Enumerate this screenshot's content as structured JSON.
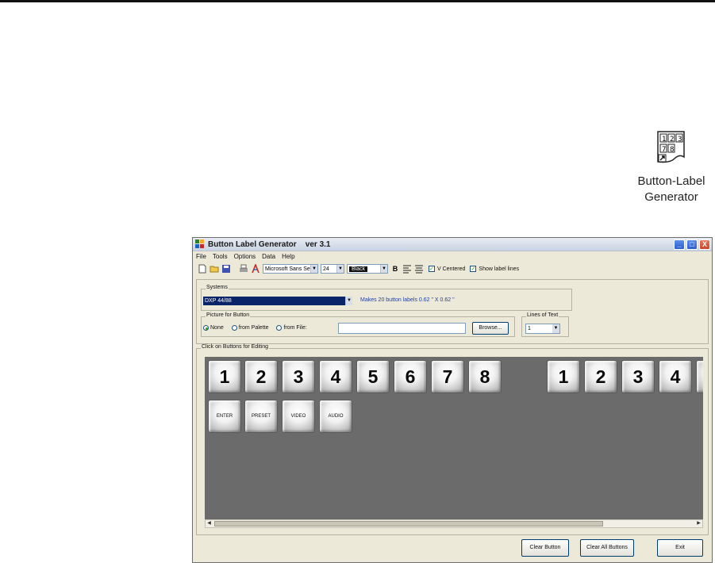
{
  "desktop_icon": {
    "caption": "Button-Label\nGenerator"
  },
  "window": {
    "title": "Button Label Generator    ver 3.1",
    "controls": {
      "minimize": "_",
      "maximize": "□",
      "close": "X"
    }
  },
  "menu": [
    "File",
    "Tools",
    "Options",
    "Data",
    "Help"
  ],
  "toolbar": {
    "font": "Microsoft Sans Serif",
    "size": "24",
    "color": "Black",
    "bold": "B",
    "v_centered": "V Centered",
    "show_label_lines": "Show label lines"
  },
  "systems": {
    "legend": "Systems",
    "selected": "DXP 44/88",
    "info": "Makes 20 button labels 0.62 \" X 0.62 \""
  },
  "picture": {
    "legend": "Picture for Button",
    "options": [
      "None",
      "from Palette",
      "from File:"
    ],
    "browse": "Browse...",
    "selected_index": 0
  },
  "lines_of_text": {
    "legend": "Lines of Text",
    "value": "1"
  },
  "buttons_area": {
    "legend": "Click on Buttons for Editing",
    "row1": [
      "1",
      "2",
      "3",
      "4",
      "5",
      "6",
      "7",
      "8"
    ],
    "row1b": [
      "1",
      "2",
      "3",
      "4"
    ],
    "row2": [
      "ENTER",
      "PRESET",
      "VIDEO",
      "AUDIO"
    ]
  },
  "footer": {
    "clear_button": "Clear Button",
    "clear_all": "Clear All Buttons",
    "exit": "Exit"
  }
}
